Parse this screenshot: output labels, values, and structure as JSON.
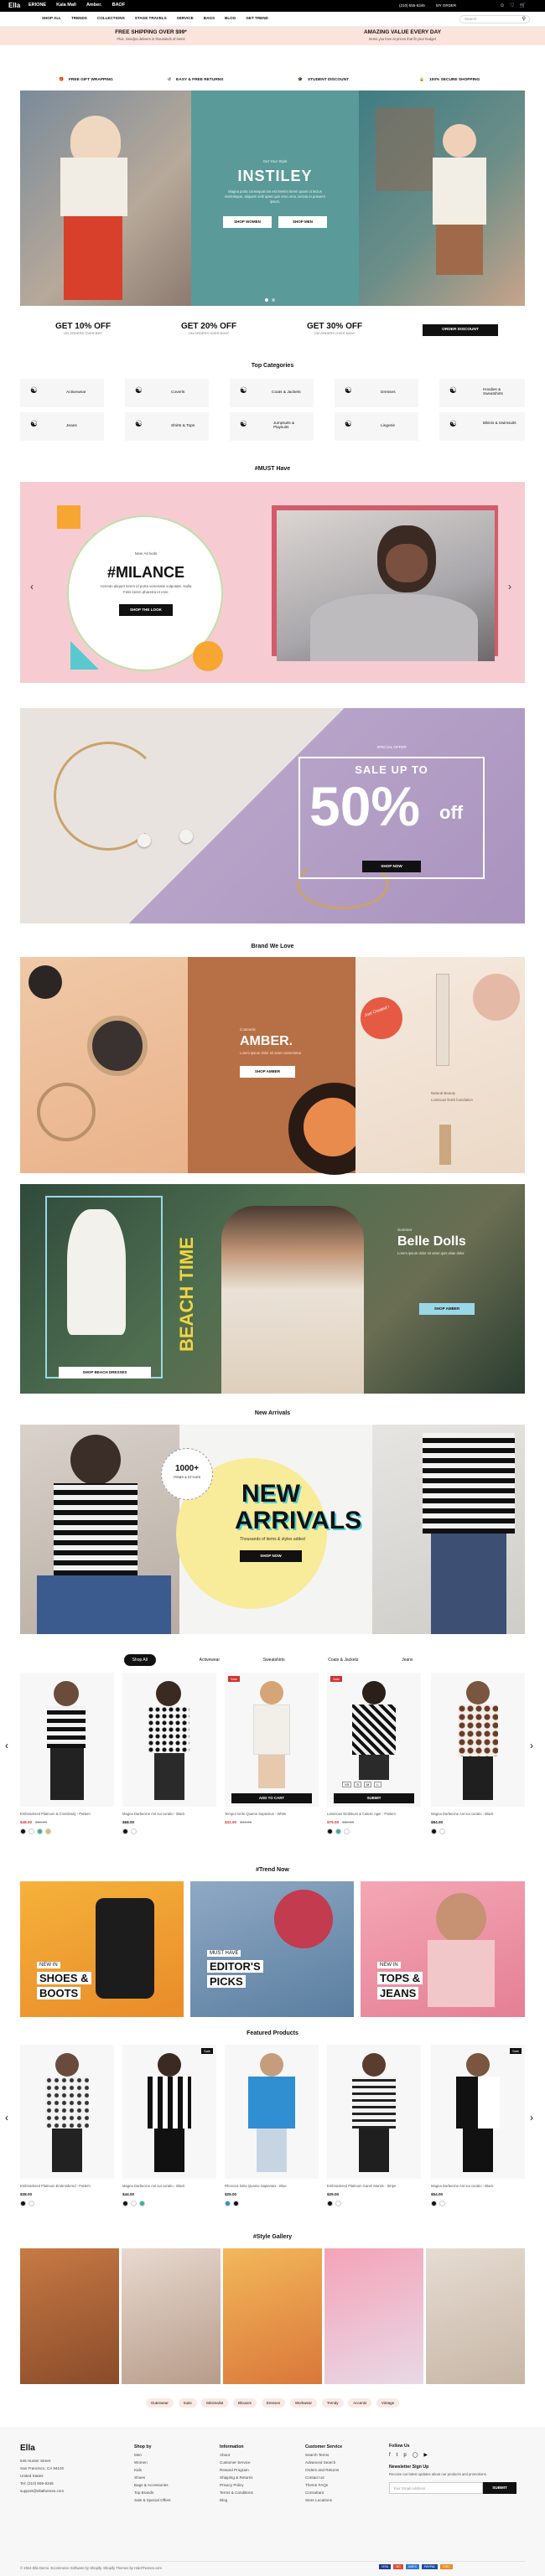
{
  "topbar": {
    "logo": "Ella",
    "brands": [
      "ERIONE",
      "Kala Mall",
      "Amber.",
      "BAOF"
    ],
    "phone": "(210) 555-6345",
    "track": "MY ORDER"
  },
  "nav": {
    "items": [
      "SHOP ALL",
      "TRENDS",
      "COLLECTIONS",
      "STAGE TRAVELS",
      "SERVICE",
      "BAGS",
      "BLOG",
      "GET TREND"
    ],
    "search_placeholder": "Search",
    "cart_count": "0"
  },
  "shipping": {
    "left_title": "FREE SHIPPING OVER $99*",
    "left_sub": "Plus, Sendpo delivers in thousands of items",
    "right_title": "AMAZING VALUE EVERY DAY",
    "right_sub": "Items you love at prices that fit your budget"
  },
  "features": [
    "FREE GIFT WRAPPING",
    "EASY & FREE RETURNS",
    "STUDENT DISCOUNT",
    "100% SECURE SHOPPING"
  ],
  "hero": {
    "kicker": "Get Your Style",
    "title": "INSTILEY",
    "text": "Magna porta consequat ras est Interim lorem quam ut lectus scelerisque, aliquam velit aptet quis eros urna, lacinia et posuere ipsum.",
    "btn1": "SHOP WOMEN",
    "btn2": "SHOP MEN"
  },
  "offers": [
    {
      "title": "GET 10% OFF",
      "sub": "ON ORDERS OVER $99*"
    },
    {
      "title": "GET 20% OFF",
      "sub": "ON ORDERS OVER $199*"
    },
    {
      "title": "GET 30% OFF",
      "sub": "ON ORDERS OVER $299*"
    }
  ],
  "offer_btn": "ORDER DISCOUNT",
  "categories": {
    "title": "Top Categories",
    "items": [
      "Activewear",
      "Coverls",
      "Coats & Jackets",
      "Dresses",
      "Hoodies & Sweatshirts",
      "Jeans",
      "Shirts & Tops",
      "Jumpsuits & Playsuits",
      "Lingerie",
      "Bikinis & Swimsuits"
    ]
  },
  "must": {
    "title": "#MUST Have",
    "kicker": "New Arrivals",
    "heading": "#MILANCE",
    "text": "Aenean aliquet lorem id porta venenatis vulputate. Nulla Felis lorem pharetra et erat.",
    "btn": "SHOP THE LOOK"
  },
  "sale": {
    "kicker": "SPECIAL OFFER",
    "line1": "SALE UP TO",
    "big": "50%",
    "off": "off",
    "btn": "SHOP NOW"
  },
  "brand": {
    "title": "Brand We Love",
    "amber_kicker": "Cosmetic",
    "amber": "AMBER.",
    "amber_text": "Lorem ipsum dolor sit amet consectetur",
    "amber_btn": "SHOP AMBER",
    "right_kicker": "Natural Beauty",
    "right_text": "Luminous finish foundation",
    "sticker": "Just Created !"
  },
  "beach": {
    "vertical": "BEACH TIME",
    "btn": "SHOP BEACH DRESSES",
    "kicker": "Summer",
    "title": "Belle Dolls",
    "text": "Lorem ipsum dolor sit amet quis vitae dolor",
    "btn2": "SHOP AMBER"
  },
  "arrivals": {
    "title": "New Arrivals",
    "badge_num": "1000+",
    "badge_text": "ITEMS & STYLES",
    "line1": "NEW",
    "line2": "ARRIVALS",
    "text": "Thousands of items & styles added",
    "btn": "SHOP NOW"
  },
  "product_tabs": [
    "Shop All",
    "Activewear",
    "Sweatshirts",
    "Coats & Jackets",
    "Jeans"
  ],
  "products": [
    {
      "name": "Embroidered Platinum & Crossbody - Pattern",
      "price": "$48.00",
      "old": "$98.00",
      "btn": "",
      "badge": ""
    },
    {
      "name": "Magna Darbecine Ant sui curatio - Black",
      "price": "$68.00",
      "old": "",
      "btn": "",
      "badge": ""
    },
    {
      "name": "Tempor lorite Quame Sapientus - White",
      "price": "$31.00",
      "old": "$44.00",
      "btn": "ADD TO CART",
      "badge": "Sale"
    },
    {
      "name": "Laminous Embleum & Caleric nger - Pattern",
      "price": "$79.00",
      "old": "$89.00",
      "btn": "SUBMIT",
      "badge": "Sale"
    },
    {
      "name": "Magna Darbecine Ant sui curatio - Black",
      "price": "$84.00",
      "old": "",
      "btn": "",
      "badge": ""
    }
  ],
  "trend": {
    "title": "#Trend Now",
    "cards": [
      {
        "small": "NEW IN",
        "big1": "SHOES &",
        "big2": "BOOTS"
      },
      {
        "small": "MUST HAVE",
        "big1": "EDITOR'S",
        "big2": "PICKS"
      },
      {
        "small": "NEW IN",
        "big1": "TOPS &",
        "big2": "JEANS"
      }
    ]
  },
  "featured": {
    "title": "Featured Products",
    "items": [
      {
        "name": "Embroidered Platinum Embroidered - Pattern",
        "price": "$38.00",
        "badge": ""
      },
      {
        "name": "Magna Darbecine Ant sui curatio - Black",
        "price": "$44.00",
        "badge": "Sale"
      },
      {
        "name": "Rhoncus lorite Quame Sapientus - Blue",
        "price": "$29.00",
        "badge": ""
      },
      {
        "name": "Embroidered Platinum Gareh Mantis - Stripe",
        "price": "$29.00",
        "badge": ""
      },
      {
        "name": "Magna Darbecine Ant sui curatio - Black",
        "price": "$54.00",
        "badge": "Sale"
      }
    ]
  },
  "gallery": {
    "title": "#Style Gallery",
    "tags": [
      "Outerwear",
      "Suits",
      "Minimalist",
      "Blouses",
      "Dresses",
      "Workwear",
      "Trendy",
      "Accents",
      "Vintage"
    ]
  },
  "footer": {
    "logo": "Ella",
    "address": [
      "545 Hunter Street",
      "San Francisco, CA 94102",
      "United States"
    ],
    "phone": "Tel: (210) 555-6345",
    "email": "support@ellathemes.com",
    "cols": [
      {
        "title": "Shop by",
        "links": [
          "Men",
          "Women",
          "Kids",
          "Shoes",
          "Bags & Accessories",
          "Top Brands",
          "Sale & Special Offers"
        ]
      },
      {
        "title": "Information",
        "links": [
          "About",
          "Customer Service",
          "Reward Program",
          "Shipping & Returns",
          "Privacy Policy",
          "Terms & Conditions",
          "Blog"
        ]
      },
      {
        "title": "Customer Service",
        "links": [
          "Search Terms",
          "Advanced Search",
          "Orders and Returns",
          "Contact Us",
          "Theme FAQs",
          "Consultant",
          "Store Locations"
        ]
      }
    ],
    "follow": "Follow Us",
    "newsletter": "Newsletter Sign Up",
    "news_text": "Receive our latest updates about our products and promotions.",
    "email_placeholder": "Your Email Address",
    "submit": "SUBMIT",
    "copyright": "© 2024 Ella Demo. Ecommerce Software by Shopify. Shopify Themes by HaloThemes.com",
    "payments": [
      "VISA",
      "MC",
      "AMEX",
      "PAYPAL",
      "DISC"
    ]
  }
}
